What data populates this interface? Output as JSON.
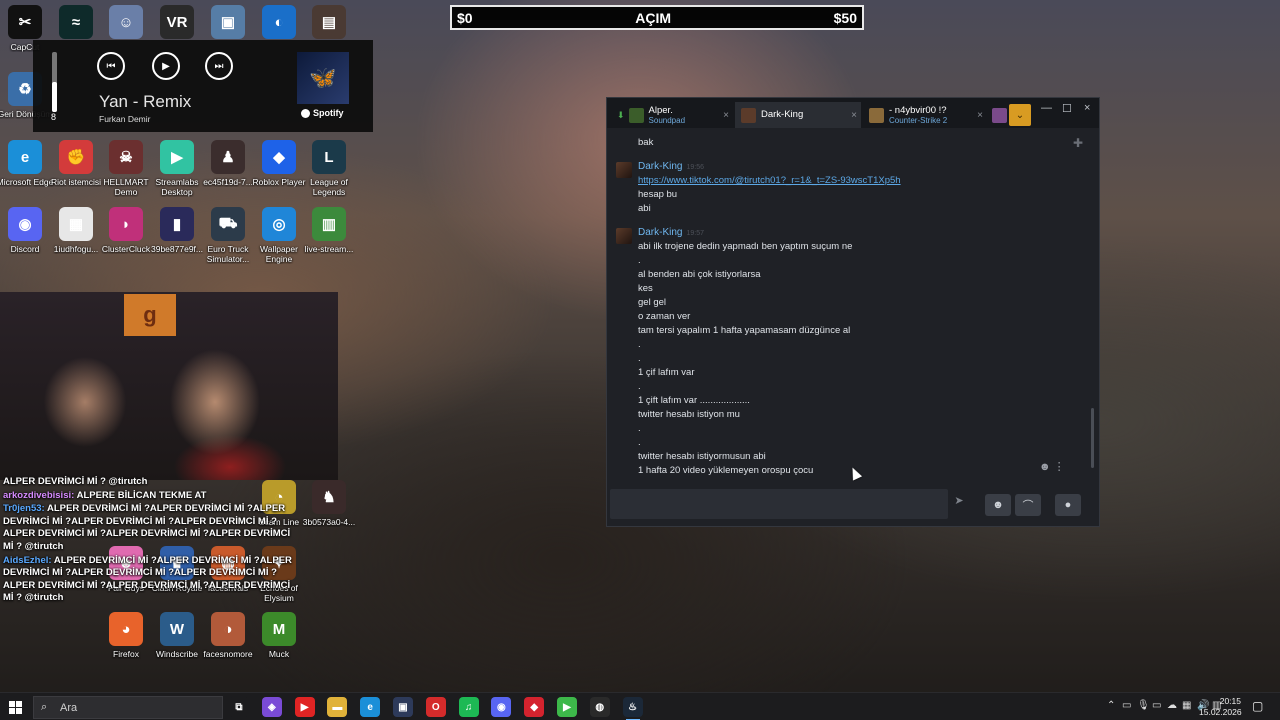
{
  "overlay": {
    "left_amount": "$0",
    "center": "AÇIM",
    "right_amount": "$50"
  },
  "desktop_icons": [
    {
      "label": "CapCut",
      "glyph": "✂",
      "color": "#111111"
    },
    {
      "label": "",
      "glyph": "≈",
      "color": "#0e2a2a"
    },
    {
      "label": "",
      "glyph": "☺",
      "color": "#6a7fa8"
    },
    {
      "label": "",
      "glyph": "VR",
      "color": "#2a2a2a"
    },
    {
      "label": "",
      "glyph": "▣",
      "color": "#567da6"
    },
    {
      "label": "",
      "glyph": "◐",
      "color": "#1a6fc9"
    },
    {
      "label": "",
      "glyph": "▤",
      "color": "#4a3a33"
    },
    {
      "label": "Geri Dönüşüm",
      "glyph": "♻",
      "color": "#3a6ea8"
    },
    {
      "label": "Microsoft Edge",
      "glyph": "e",
      "color": "#1b8fd8"
    },
    {
      "label": "Riot istemcisi",
      "glyph": "✊",
      "color": "#d33b3b"
    },
    {
      "label": "HELLMART Demo",
      "glyph": "☠",
      "color": "#6b2f2f"
    },
    {
      "label": "Streamlabs Desktop",
      "glyph": "▶",
      "color": "#31c3a2"
    },
    {
      "label": "ec45f19d-7...",
      "glyph": "♟",
      "color": "#3b2d2d"
    },
    {
      "label": "Roblox Player",
      "glyph": "◆",
      "color": "#1e62e8"
    },
    {
      "label": "League of Legends",
      "glyph": "L",
      "color": "#1b3a4a"
    },
    {
      "label": "Discord",
      "glyph": "◉",
      "color": "#5865f2"
    },
    {
      "label": "1iudhfogu...",
      "glyph": "▦",
      "color": "#e7e7e7"
    },
    {
      "label": "ClusterCluck",
      "glyph": "◗",
      "color": "#c0307a"
    },
    {
      "label": "39be877e9f...",
      "glyph": "▮",
      "color": "#2a2a5a"
    },
    {
      "label": "Euro Truck Simulator...",
      "glyph": "⛟",
      "color": "#2c3b4a"
    },
    {
      "label": "Wallpaper Engine",
      "glyph": "◎",
      "color": "#1f86d8"
    },
    {
      "label": "live-stream...",
      "glyph": "▥",
      "color": "#3c8a3c"
    },
    {
      "label": "Scam Line",
      "glyph": "◔",
      "color": "#b99b2a"
    },
    {
      "label": "3b0573a0-4...",
      "glyph": "♞",
      "color": "#3a2a2a"
    },
    {
      "label": "Fall Guys",
      "glyph": "☻",
      "color": "#e06ab0"
    },
    {
      "label": "Clash Royale",
      "glyph": "♛",
      "color": "#2f5ea8"
    },
    {
      "label": "facesrivals",
      "glyph": "◍",
      "color": "#c95a2b"
    },
    {
      "label": "Echoes of Elysium",
      "glyph": "✦",
      "color": "#6a3a1a"
    },
    {
      "label": "Firefox",
      "glyph": "◕",
      "color": "#e8632b"
    },
    {
      "label": "Windscribe",
      "glyph": "W",
      "color": "#2b5c8a"
    },
    {
      "label": "facesnomore",
      "glyph": "◑",
      "color": "#b25a3a"
    },
    {
      "label": "Muck",
      "glyph": "M",
      "color": "#3c8a2a"
    }
  ],
  "media": {
    "volume_level": "8",
    "volume_fraction": 0.5,
    "track": "Yan - Remix",
    "artist": "Furkan Demir",
    "brand": "Spotify",
    "prev_label": "⏮",
    "play_label": "▶",
    "next_label": "⏭"
  },
  "twitch_chat": [
    {
      "user": "",
      "color": "#ffffff",
      "text": "ALPER DEVRİMCİ Mİ ? @tirutch"
    },
    {
      "user": "arkozdivebisisi:",
      "color": "#d68bff",
      "text": "ALPERE BİLİCAN TEKME AT"
    },
    {
      "user": "Tr0jen53:",
      "color": "#5aa9ff",
      "text": "ALPER DEVRİMCİ Mİ ?ALPER DEVRİMCİ Mİ ?ALPER DEVRİMCİ Mİ ?ALPER DEVRİMCİ Mİ ?ALPER DEVRİMCİ Mİ ?ALPER DEVRİMCİ Mİ ?ALPER DEVRİMCİ Mİ ?ALPER DEVRİMCİ Mİ ? @tirutch"
    },
    {
      "user": "AidsEzhel:",
      "color": "#5aa9ff",
      "text": "ALPER DEVRİMCİ Mİ ?ALPER DEVRİMCİ Mİ ?ALPER DEVRİMCİ Mİ ?ALPER DEVRİMCİ Mİ ?ALPER DEVRİMCİ Mİ ?ALPER DEVRİMCİ Mİ ?ALPER DEVRİMCİ Mİ ?ALPER DEVRİMCİ Mİ ? @tirutch"
    }
  ],
  "steam": {
    "tabs": [
      {
        "name": "Alper.",
        "sub": "Soundpad",
        "color": "#3b5d2a"
      },
      {
        "name": "Dark-King",
        "sub": "",
        "color": "#5b3b2a"
      },
      {
        "name": "- n4ybvir00 !?",
        "sub": "Counter-Strike 2",
        "color": "#8a6a3a"
      }
    ],
    "close_label": "×",
    "messages": [
      {
        "kind": "text",
        "text": "bak"
      },
      {
        "kind": "sender",
        "name": "Dark-King",
        "time": "19:56"
      },
      {
        "kind": "link",
        "text": "https://www.tiktok.com/@tirutch01?_r=1&_t=ZS-93wscT1Xp5h"
      },
      {
        "kind": "text",
        "text": "hesap bu"
      },
      {
        "kind": "text",
        "text": "abi"
      },
      {
        "kind": "sender",
        "name": "Dark-King",
        "time": "19:57"
      },
      {
        "kind": "text",
        "text": "abi ilk trojene dedin yapmadı ben yaptım suçum ne"
      },
      {
        "kind": "text",
        "text": "."
      },
      {
        "kind": "text",
        "text": "al benden abi çok istiyorlarsa"
      },
      {
        "kind": "text",
        "text": "kes"
      },
      {
        "kind": "text",
        "text": "gel gel"
      },
      {
        "kind": "text",
        "text": "o zaman ver"
      },
      {
        "kind": "text",
        "text": "tam tersi yapalım 1 hafta yapamasam düzgünce al"
      },
      {
        "kind": "text",
        "text": "."
      },
      {
        "kind": "text",
        "text": "."
      },
      {
        "kind": "text",
        "text": "1 çif lafım var"
      },
      {
        "kind": "text",
        "text": "."
      },
      {
        "kind": "text",
        "text": "1 çift lafım var ..................."
      },
      {
        "kind": "text",
        "text": "twitter hesabı istiyon mu"
      },
      {
        "kind": "text",
        "text": "."
      },
      {
        "kind": "text",
        "text": "."
      },
      {
        "kind": "text",
        "text": "twitter hesabı istiyormusun abi"
      },
      {
        "kind": "text",
        "text": "1 hafta 20 video yüklemeyen orospu çocu"
      }
    ],
    "controls": {
      "minimize": "—",
      "maximize": "☐",
      "close": "×",
      "send": "➤",
      "emoji": "☻",
      "attach": "⌒",
      "voice": "●",
      "pin": "✚",
      "collapse": "⌄"
    }
  },
  "taskbar": {
    "search_placeholder": "Ara",
    "search_icon": "⌕",
    "apps": [
      {
        "name": "task-view",
        "glyph": "⧉",
        "color": "#1c1c1e"
      },
      {
        "name": "copilot",
        "glyph": "◈",
        "color": "#7a4bd6"
      },
      {
        "name": "youtube",
        "glyph": "▶",
        "color": "#e02424"
      },
      {
        "name": "file-explorer",
        "glyph": "▬",
        "color": "#e0b23a"
      },
      {
        "name": "edge",
        "glyph": "e",
        "color": "#1b8fd8"
      },
      {
        "name": "app-dark",
        "glyph": "▣",
        "color": "#2d3a5a"
      },
      {
        "name": "opera",
        "glyph": "O",
        "color": "#d42b2b"
      },
      {
        "name": "spotify",
        "glyph": "♫",
        "color": "#1db954"
      },
      {
        "name": "discord",
        "glyph": "◉",
        "color": "#5865f2"
      },
      {
        "name": "app-red",
        "glyph": "◆",
        "color": "#d4232e"
      },
      {
        "name": "app-green",
        "glyph": "▶",
        "color": "#3db84a"
      },
      {
        "name": "obs",
        "glyph": "◍",
        "color": "#2a2a2a"
      },
      {
        "name": "steam",
        "glyph": "♨",
        "color": "#1b2838",
        "active": true
      }
    ],
    "tray": [
      "⌃",
      "▭",
      "🎙",
      "▭",
      "☁",
      "▦",
      "🔊",
      "▥"
    ],
    "time": "20:15",
    "date": "15.02.2026",
    "notification": "▢"
  }
}
